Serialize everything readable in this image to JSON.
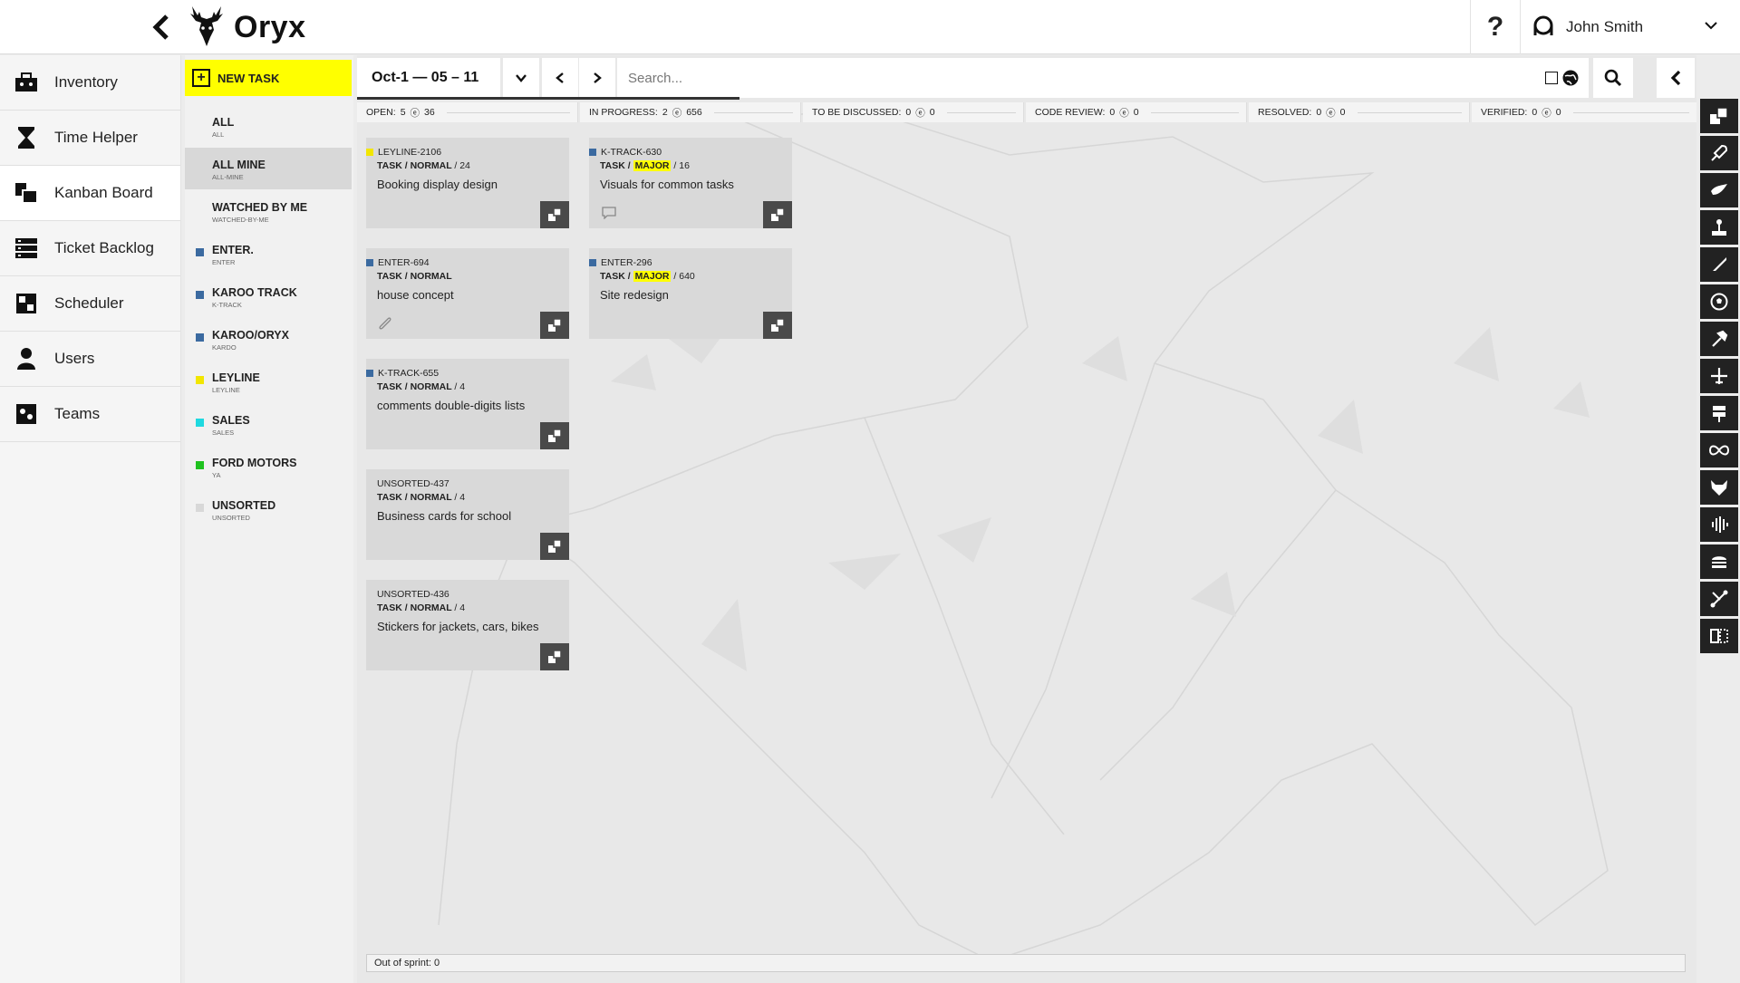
{
  "app": {
    "name": "Oryx"
  },
  "header": {
    "help_label": "?",
    "user_name": "John Smith"
  },
  "nav": {
    "items": [
      {
        "label": "Inventory",
        "icon": "toolbox-icon"
      },
      {
        "label": "Time Helper",
        "icon": "hourglass-icon"
      },
      {
        "label": "Kanban Board",
        "icon": "kanban-icon",
        "active": true
      },
      {
        "label": "Ticket Backlog",
        "icon": "backlog-icon"
      },
      {
        "label": "Scheduler",
        "icon": "scheduler-icon"
      },
      {
        "label": "Users",
        "icon": "users-icon"
      },
      {
        "label": "Teams",
        "icon": "teams-icon"
      }
    ]
  },
  "filters": {
    "new_task_label": "NEW TASK",
    "projects": [
      {
        "name": "ALL",
        "sub": "ALL",
        "color": ""
      },
      {
        "name": "ALL MINE",
        "sub": "ALL-MINE",
        "color": "",
        "active": true
      },
      {
        "name": "WATCHED BY ME",
        "sub": "WATCHED-BY-ME",
        "color": ""
      },
      {
        "name": "ENTER.",
        "sub": "ENTER",
        "color": "#3b6aa0"
      },
      {
        "name": "KAROO TRACK",
        "sub": "K-TRACK",
        "color": "#3b6aa0"
      },
      {
        "name": "KAROO/ORYX",
        "sub": "KARDO",
        "color": "#3b6aa0"
      },
      {
        "name": "LEYLINE",
        "sub": "LEYLINE",
        "color": "#f2e600"
      },
      {
        "name": "SALES",
        "sub": "SALES",
        "color": "#1fd9e0"
      },
      {
        "name": "FORD MOTORS",
        "sub": "YA",
        "color": "#1fc21f"
      },
      {
        "name": "UNSORTED",
        "sub": "UNSORTED",
        "color": "#d8d8d8"
      }
    ]
  },
  "toolbar": {
    "date_range": "Oct-1 — 05 – 11",
    "search_placeholder": "Search..."
  },
  "columns": [
    {
      "label": "OPEN:",
      "count": "5",
      "sum": "36"
    },
    {
      "label": "IN PROGRESS:",
      "count": "2",
      "sum": "656"
    },
    {
      "label": "TO BE DISCUSSED:",
      "count": "0",
      "sum": "0"
    },
    {
      "label": "CODE REVIEW:",
      "count": "0",
      "sum": "0"
    },
    {
      "label": "RESOLVED:",
      "count": "0",
      "sum": "0"
    },
    {
      "label": "VERIFIED:",
      "count": "0",
      "sum": "0"
    }
  ],
  "cards": {
    "open": [
      {
        "key": "LEYLINE-2106",
        "color": "#f2e600",
        "type": "TASK /",
        "priority": "NORMAL",
        "estimate": "/ 24",
        "title": "Booking display design",
        "extra_icon": ""
      },
      {
        "key": "ENTER-694",
        "color": "#3b6aa0",
        "type": "TASK /",
        "priority": "NORMAL",
        "estimate": "",
        "title": "house concept",
        "extra_icon": "attachment-icon"
      },
      {
        "key": "K-TRACK-655",
        "color": "#3b6aa0",
        "type": "TASK /",
        "priority": "NORMAL",
        "estimate": "/ 4",
        "title": "comments double-digits lists",
        "extra_icon": ""
      },
      {
        "key": "UNSORTED-437",
        "color": "",
        "type": "TASK /",
        "priority": "NORMAL",
        "estimate": "/ 4",
        "title": "Business cards for school",
        "extra_icon": ""
      },
      {
        "key": "UNSORTED-436",
        "color": "",
        "type": "TASK /",
        "priority": "NORMAL",
        "estimate": "/ 4",
        "title": "Stickers for jackets, cars, bikes",
        "extra_icon": ""
      }
    ],
    "in_progress": [
      {
        "key": "K-TRACK-630",
        "color": "#3b6aa0",
        "type": "TASK /",
        "priority": "MAJOR",
        "estimate": "/ 16",
        "title": "Visuals for common tasks",
        "extra_icon": "comment-icon"
      },
      {
        "key": "ENTER-296",
        "color": "#3b6aa0",
        "type": "TASK /",
        "priority": "MAJOR",
        "estimate": "/ 640",
        "title": "Site redesign",
        "extra_icon": ""
      }
    ]
  },
  "footer": {
    "out_of_sprint": "Out of sprint: 0"
  },
  "tools": [
    "tool-1-icon",
    "tool-2-icon",
    "tool-3-icon",
    "tool-4-icon",
    "tool-5-icon",
    "tool-6-icon",
    "tool-7-icon",
    "tool-8-icon",
    "tool-9-icon",
    "tool-10-icon",
    "tool-11-icon",
    "tool-12-icon",
    "tool-13-icon",
    "tool-14-icon",
    "tool-15-icon"
  ],
  "colors": {
    "accent": "#ffff00",
    "dark": "#222222"
  }
}
